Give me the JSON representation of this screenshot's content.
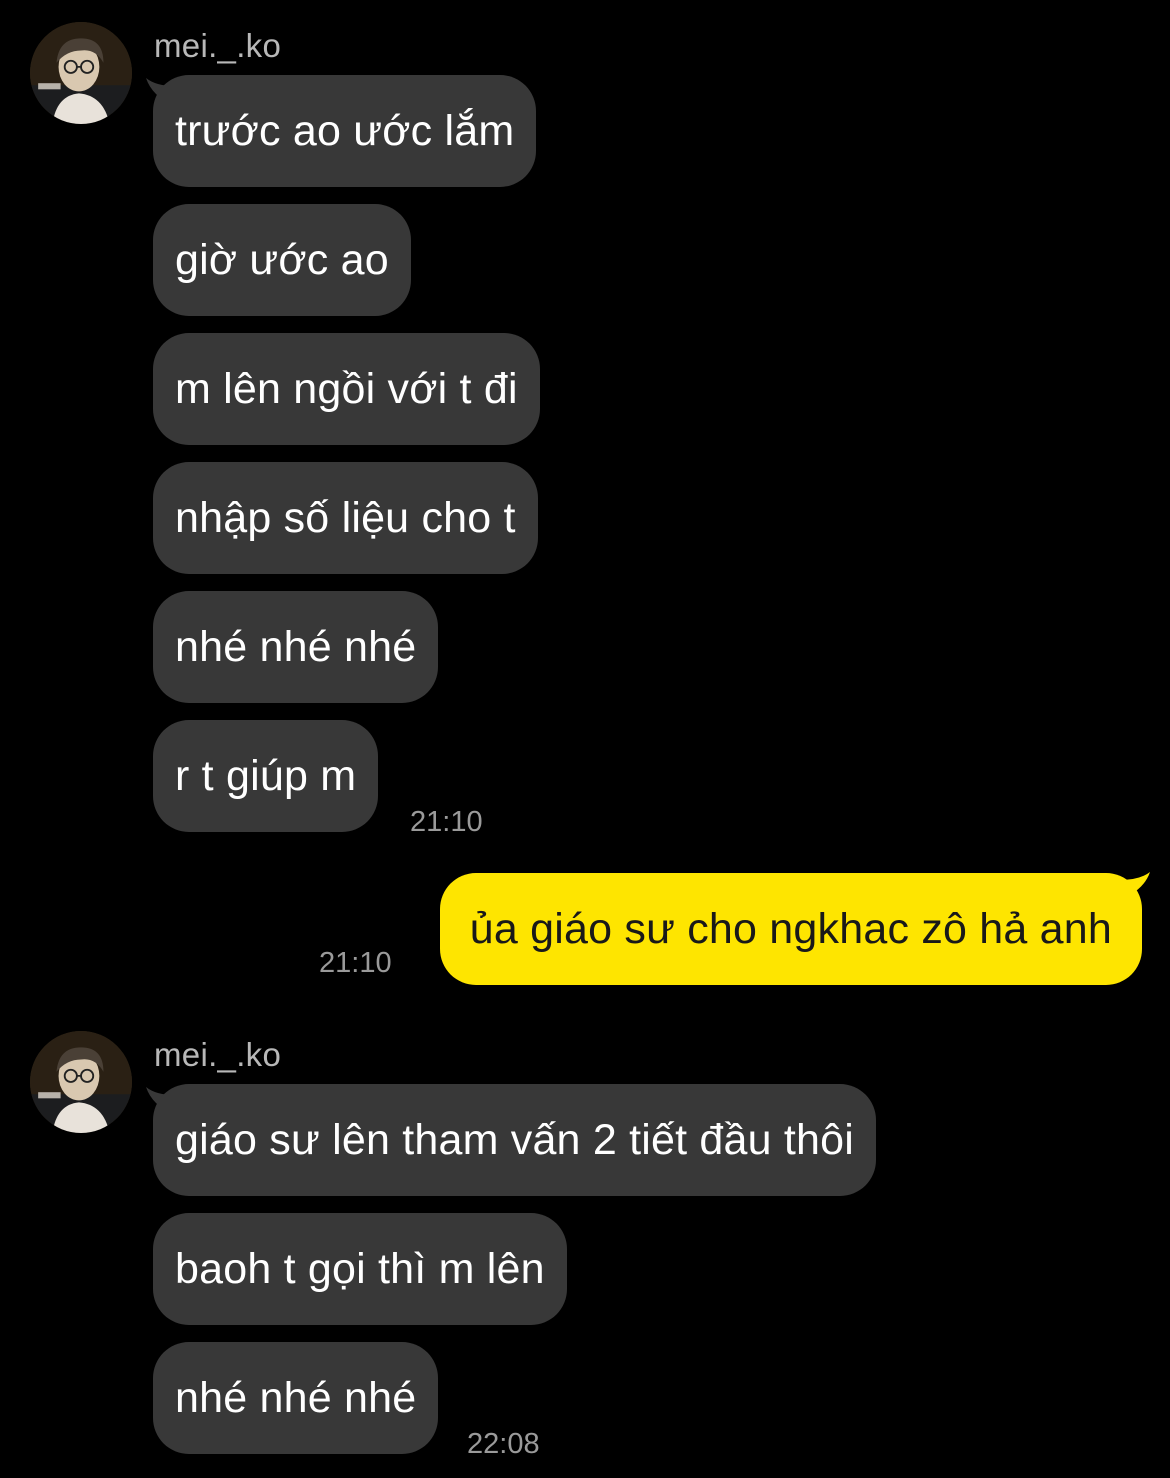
{
  "groups": [
    {
      "sender": "mei._.ko",
      "avatar_icon": "profile-avatar",
      "messages": [
        "trước ao ước lắm",
        "giờ ước ao",
        "m lên ngồi với t đi",
        "nhập số liệu cho t",
        "nhé nhé nhé",
        "r t giúp m"
      ],
      "time": "21:10"
    },
    {
      "outgoing": true,
      "messages": [
        "ủa giáo sư cho ngkhac zô hả anh"
      ],
      "time": "21:10"
    },
    {
      "sender": "mei._.ko",
      "avatar_icon": "profile-avatar",
      "messages": [
        "giáo sư lên tham vấn 2 tiết đầu thôi",
        "baoh t gọi thì m lên",
        "nhé nhé nhé"
      ],
      "time": "22:08"
    }
  ],
  "colors": {
    "background": "#000000",
    "incoming_bubble": "#383838",
    "outgoing_bubble": "#fee500",
    "incoming_text": "#ffffff",
    "outgoing_text": "#191919",
    "sender_name": "#b8b8b8",
    "timestamp": "#9a9a9a"
  }
}
